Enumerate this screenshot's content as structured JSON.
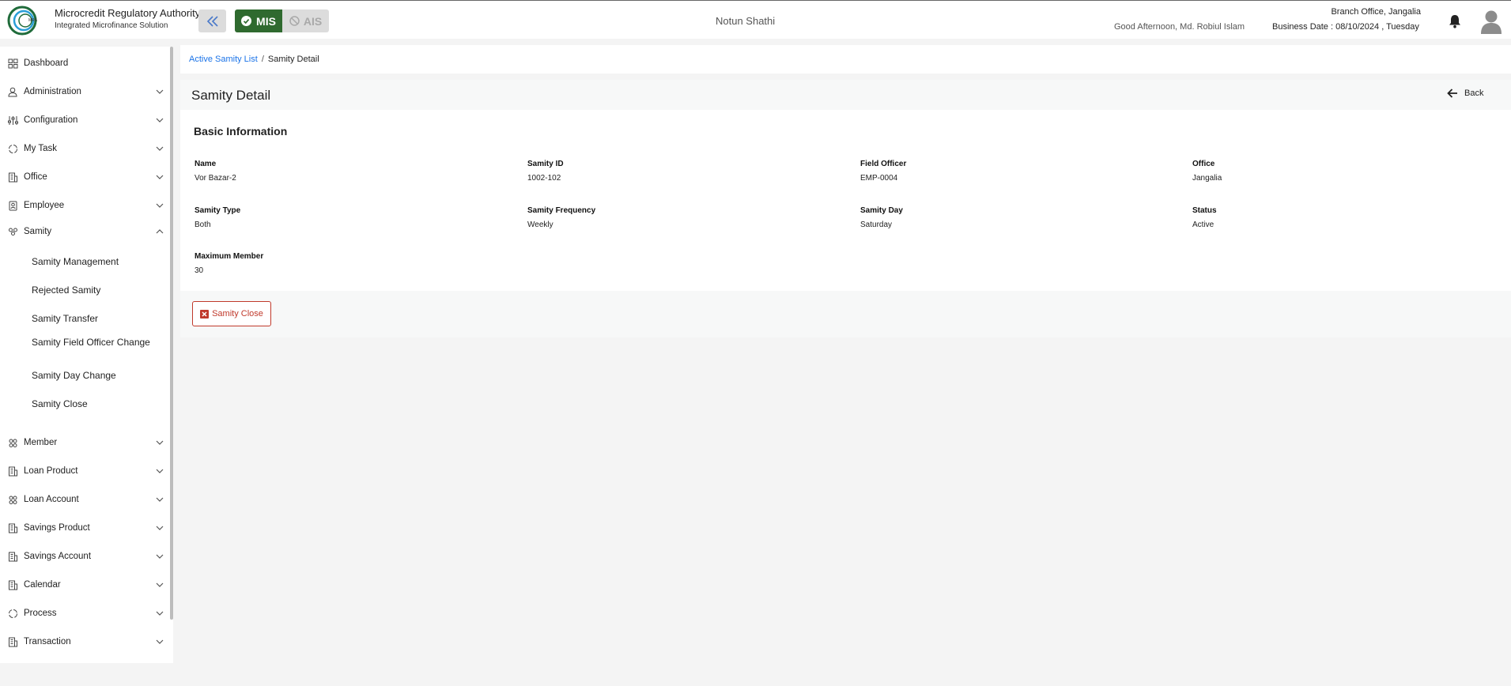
{
  "header": {
    "org_name": "Microcredit Regulatory Authority",
    "org_subtitle": "Integrated Microfinance Solution",
    "mode_mis": "MIS",
    "mode_ais": "AIS",
    "app_name": "Notun Shathi",
    "greeting": "Good Afternoon, Md. Robiul Islam",
    "branch": "Branch Office, Jangalia",
    "business_date": "Business Date : 08/10/2024 , Tuesday",
    "colors": {
      "mis_active": "#2f6a2f",
      "ais_inactive": "#dcdcdc"
    }
  },
  "sidebar": {
    "items": [
      {
        "label": "Dashboard",
        "icon": "dashboard-icon"
      },
      {
        "label": "Administration",
        "icon": "admin-icon"
      },
      {
        "label": "Configuration",
        "icon": "config-icon"
      },
      {
        "label": "My Task",
        "icon": "task-icon"
      },
      {
        "label": "Office",
        "icon": "office-icon"
      },
      {
        "label": "Employee",
        "icon": "employee-icon"
      },
      {
        "label": "Samity",
        "icon": "samity-icon"
      },
      {
        "label": "Member",
        "icon": "member-icon"
      },
      {
        "label": "Loan Product",
        "icon": "loan-product-icon"
      },
      {
        "label": "Loan Account",
        "icon": "loan-account-icon"
      },
      {
        "label": "Savings Product",
        "icon": "savings-product-icon"
      },
      {
        "label": "Savings Account",
        "icon": "savings-account-icon"
      },
      {
        "label": "Calendar",
        "icon": "calendar-icon"
      },
      {
        "label": "Process",
        "icon": "process-icon"
      },
      {
        "label": "Transaction",
        "icon": "transaction-icon"
      }
    ],
    "samity_subitems": [
      "Samity Management",
      "Rejected Samity",
      "Samity Transfer",
      "Samity Field Officer Change",
      "Samity Day Change",
      "Samity Close"
    ]
  },
  "breadcrumb": {
    "link": "Active Samity List",
    "separator": "/",
    "current": "Samity Detail"
  },
  "detail": {
    "title": "Samity Detail",
    "back_label": "Back",
    "section_title": "Basic Information",
    "fields": [
      {
        "label": "Name",
        "value": "Vor Bazar-2"
      },
      {
        "label": "Samity ID",
        "value": "1002-102"
      },
      {
        "label": "Field Officer",
        "value": "EMP-0004"
      },
      {
        "label": "Office",
        "value": "Jangalia"
      },
      {
        "label": "Samity Type",
        "value": "Both"
      },
      {
        "label": "Samity Frequency",
        "value": "Weekly"
      },
      {
        "label": "Samity Day",
        "value": "Saturday"
      },
      {
        "label": "Status",
        "value": "Active"
      },
      {
        "label": "Maximum Member",
        "value": "30"
      }
    ],
    "close_button": "Samity Close"
  }
}
